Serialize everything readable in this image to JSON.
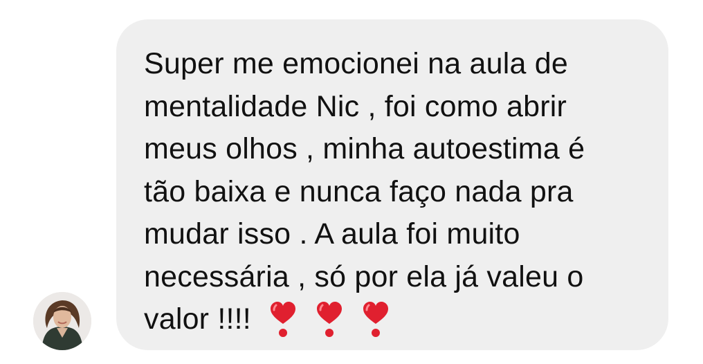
{
  "message": {
    "lines": [
      "Super me emocionei na aula de",
      "mentalidade Nic , foi como abrir",
      "meus olhos , minha autoestima é",
      "tão baixa e nunca faço nada pra",
      "mudar isso . A aula foi muito",
      "necessária , só por ela já valeu o",
      "valor !!!!"
    ],
    "emoji": [
      "heavy-heart-exclamation-icon",
      "heavy-heart-exclamation-icon",
      "heavy-heart-exclamation-icon"
    ]
  },
  "colors": {
    "bubble": "#efefef",
    "text": "#111111",
    "heart": "#e0202f"
  }
}
